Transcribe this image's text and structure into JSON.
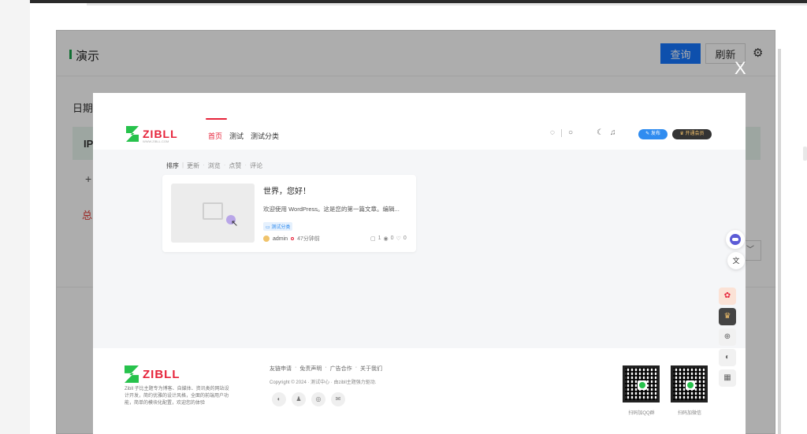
{
  "admin": {
    "title": "演示",
    "query_label": "查询",
    "refresh_label": "刷新",
    "date_label": "日期",
    "ip_header": "IP",
    "expand_symbol": "+",
    "total_label": "总"
  },
  "modal": {
    "close_label": "X"
  },
  "site": {
    "logo_text": "ZIBLL",
    "logo_sub": "WWW.ZIBLL.COM",
    "nav": [
      "首页",
      "测试",
      "测试分类"
    ],
    "publish_label": "发布",
    "vip_label": "开通会员",
    "sort_tabs": [
      "排序",
      "更新",
      "浏览",
      "点赞",
      "评论"
    ],
    "post": {
      "title": "世界，您好！",
      "excerpt": "欢迎使用 WordPress。这是您的第一篇文章。编辑...",
      "tag": "测试分类",
      "author": "admin",
      "time": "47分钟前",
      "comments": "1",
      "views": "0",
      "likes": "0"
    },
    "footer": {
      "desc": "Zibll 子比主题专为博客、自媒体、资讯类的网站设计开发，简约优雅的设计风格，全面的前端用户功能，简单的模块化配置，欢迎您的体验",
      "links": [
        "友链申请",
        "免责声明",
        "广告合作",
        "关于我们"
      ],
      "copyright": "Copyright © 2024 · 测试中心 · 由zibll主题强力驱动.",
      "qr_qq_label": "扫码加QQ群",
      "qr_wx_label": "扫码加微信"
    }
  },
  "icons": {
    "gear": "⚙",
    "bulb": "◌",
    "search": "○",
    "moon": "☾",
    "bell": "♫",
    "cursor": "↖",
    "translate": "文"
  },
  "colors": {
    "accent_red": "#e6233a",
    "brand_green": "#27c24c",
    "primary_blue": "#1677ff"
  }
}
